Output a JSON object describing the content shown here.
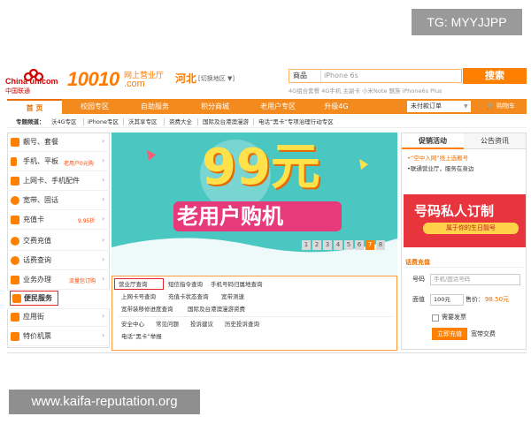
{
  "watermarks": {
    "top": "TG: MYYJJPP",
    "bottom": "www.kaifa-reputation.org"
  },
  "header": {
    "brand_en": "China unicom",
    "brand_cn": "中国联通",
    "number": "10010",
    "dotcom": ".com",
    "tagline": "网上营业厅",
    "province": "河北",
    "switch": "[切换地区 ▼]",
    "search_category": "商品",
    "search_placeholder": "iPhone 6s",
    "search_button": "搜索",
    "hot_words": "4G组合套餐  4G手机  主副卡  小米Note  魅族  iPhone6s Plus"
  },
  "nav": {
    "items": [
      "首 页",
      "校园专区",
      "自助服务",
      "积分商城",
      "老用户专区",
      "升级4G"
    ],
    "order": "未付款订单",
    "cart": "购物车"
  },
  "subnav": {
    "label": "专题频道：",
    "items": [
      "沃4G专区",
      "iPhone专区",
      "沃其享专区",
      "资费大全",
      "国际及台港澳漫游",
      "电话“黑卡”专项治理行动专区"
    ]
  },
  "left_nav": {
    "items": [
      {
        "label": "靓号、套餐",
        "sub": ""
      },
      {
        "label": "手机、平板",
        "sub": "老用户0元购"
      },
      {
        "label": "上网卡、手机配件",
        "sub": ""
      },
      {
        "label": "宽带、固话",
        "sub": ""
      },
      {
        "label": "充值卡",
        "sub": "9.95折"
      },
      {
        "label": "交费充值",
        "sub": ""
      },
      {
        "label": "话费查询",
        "sub": ""
      },
      {
        "label": "业务办理",
        "sub": "流量包订购"
      },
      {
        "label": "便民服务",
        "sub": ""
      },
      {
        "label": "应用街",
        "sub": ""
      },
      {
        "label": "特价机票",
        "sub": ""
      }
    ]
  },
  "banner": {
    "big": "99元",
    "sub": "老用户购机",
    "pages": [
      "1",
      "2",
      "3",
      "4",
      "5",
      "6",
      "7",
      "8"
    ],
    "active_page": "7"
  },
  "dropdown": {
    "rows": [
      [
        "营业厅查询",
        "短信指令查询",
        "手机号码归属地查询"
      ],
      [
        "上网卡号查询",
        "充值卡状态查询",
        "宽带测速"
      ],
      [
        "宽带装移修进度查询",
        "国际及台港澳漫游资费"
      ],
      [
        "安全中心",
        "常见问题",
        "投诉建议",
        "历史投诉查询"
      ],
      [
        "电话“黑卡”举报"
      ]
    ]
  },
  "right": {
    "tab_active": "促销活动",
    "tab_inactive": "公告资讯",
    "promos": [
      "•“空中入网”线上选靓号",
      "•联通营业厅，服务在身边"
    ],
    "ad_title": "号码私人订制",
    "ad_sub": "属于你的生日靓号",
    "recharge_title": "话费充值",
    "phone_label": "号码",
    "phone_placeholder": "手机/固话号码",
    "amount_label": "面值",
    "amount_value": "100元",
    "price_label": "售价：",
    "price_value": "98.50元",
    "invoice_label": "需要发票",
    "charge_button": "立即充值",
    "broadband_link": "宽带交费"
  },
  "colors": {
    "accent": "#ff8000",
    "nav": "#f28a1e",
    "banner": "#4bc7c2",
    "highlight": "#e0252a"
  }
}
